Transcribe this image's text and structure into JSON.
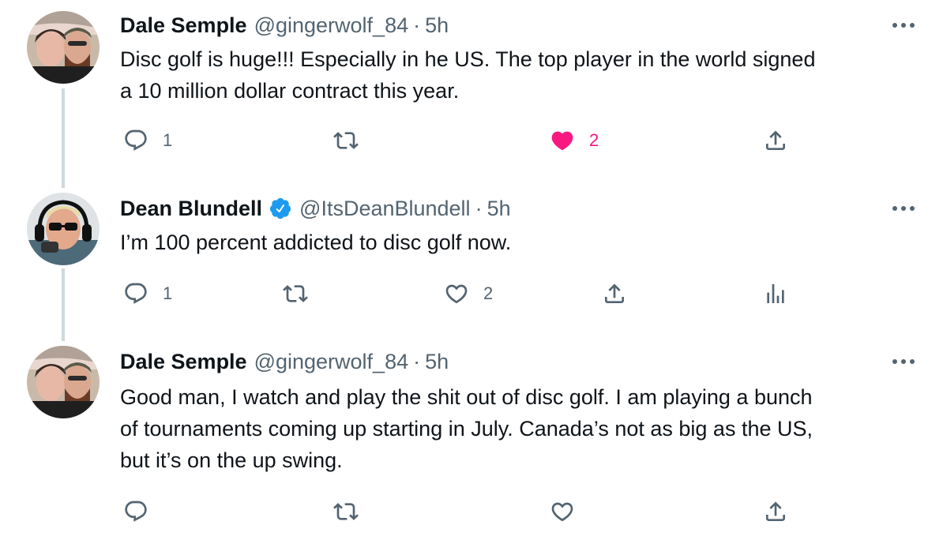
{
  "tweets": [
    {
      "name": "Dale Semple",
      "handle": "@gingerwolf_84",
      "dot": "·",
      "time": "5h",
      "text_lines": [
        "Disc golf is huge!!! Especially in he US. The top player in the world signed",
        "a 10 million dollar contract this year."
      ],
      "reply_count": "1",
      "like_count": "2",
      "liked": true
    },
    {
      "name": "Dean Blundell",
      "handle": "@ItsDeanBlundell",
      "dot": "·",
      "time": "5h",
      "verified": true,
      "text_lines": [
        "I’m 100 percent addicted to disc golf now."
      ],
      "reply_count": "1",
      "like_count": "2",
      "liked": false
    },
    {
      "name": "Dale Semple",
      "handle": "@gingerwolf_84",
      "dot": "·",
      "time": "5h",
      "text_lines": [
        "Good man, I watch and play the shit out of disc golf.  I am playing a bunch",
        "of tournaments coming up starting in July.  Canada’s not as big as the US,",
        "but it’s on the up swing."
      ],
      "reply_count": "",
      "like_count": "",
      "liked": false
    }
  ],
  "colors": {
    "text": "#0f1419",
    "secondary": "#536471",
    "like_active": "#f91880",
    "verified": "#1d9bf0",
    "thread_line": "#cfd9de"
  },
  "icons": [
    "reply-icon",
    "retweet-icon",
    "like-icon",
    "share-icon",
    "analytics-icon",
    "more-icon",
    "verified-badge-icon"
  ]
}
